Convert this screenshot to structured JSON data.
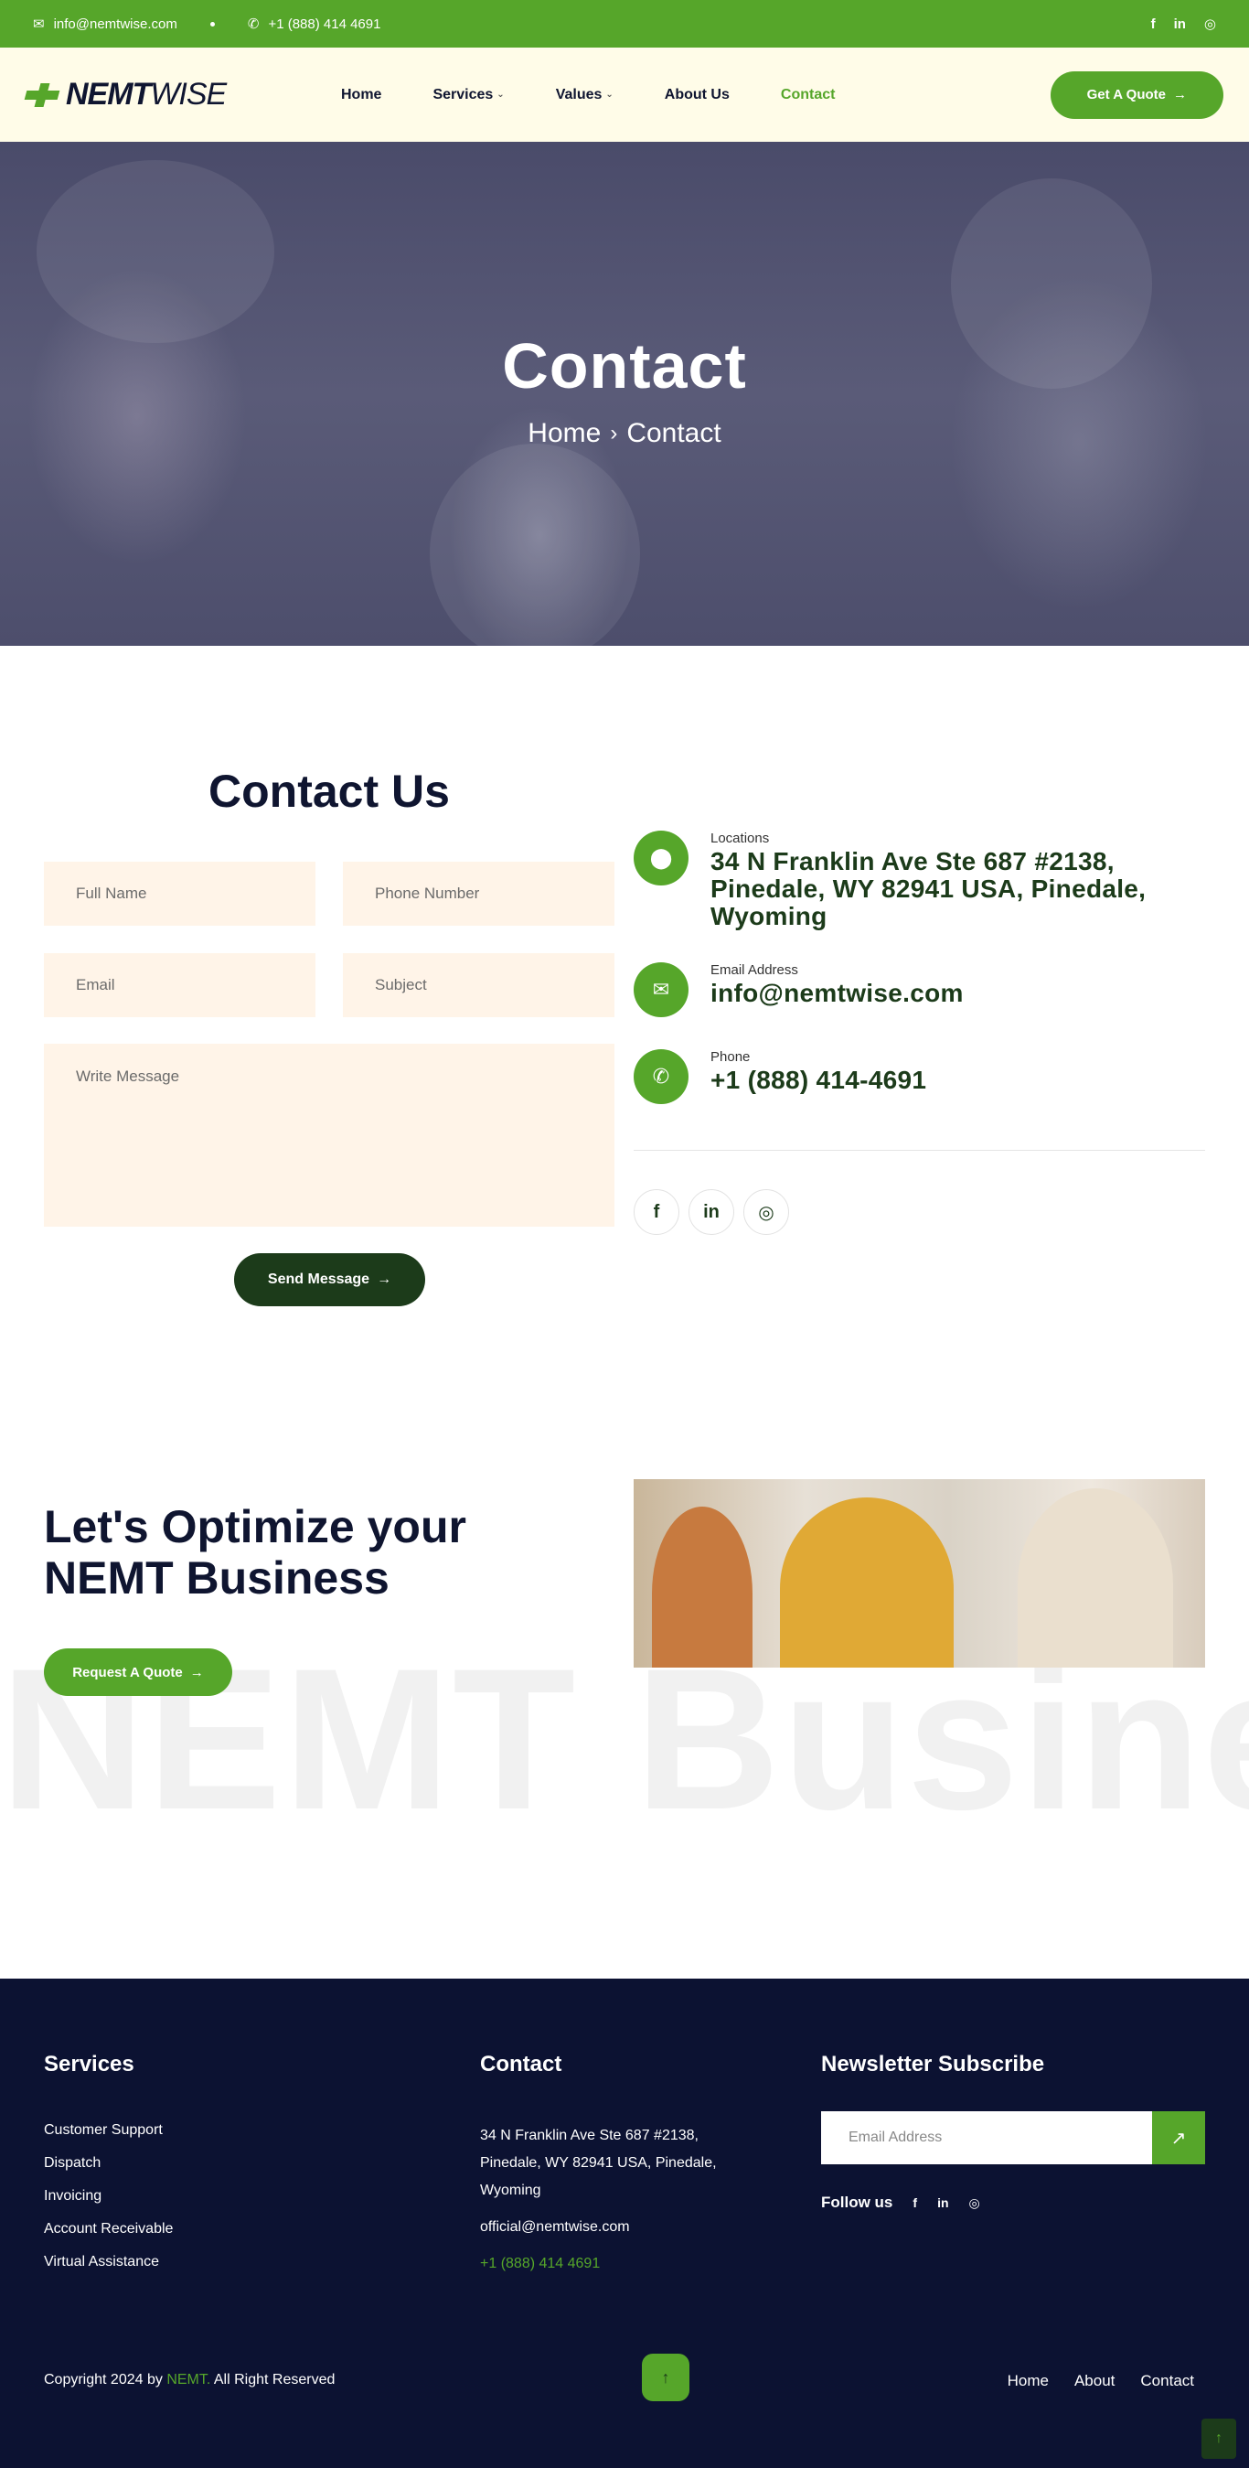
{
  "topbar": {
    "email": "info@nemtwise.com",
    "phone": "+1 (888) 414 4691",
    "social": [
      "f",
      "in",
      "◎"
    ]
  },
  "nav": {
    "logo_bold": "NEMT",
    "logo_light": "WISE",
    "items": [
      "Home",
      "Services",
      "Values",
      "About Us",
      "Contact"
    ],
    "quote_label": "Get A Quote"
  },
  "hero": {
    "title": "Contact",
    "crumb_home": "Home",
    "crumb_current": "Contact"
  },
  "contact": {
    "title": "Contact Us",
    "fields": {
      "full_name": "Full Name",
      "phone": "Phone Number",
      "email": "Email",
      "subject": "Subject",
      "message": "Write Message"
    },
    "send_label": "Send Message",
    "info": [
      {
        "label": "Locations",
        "value": "34 N Franklin Ave Ste 687 #2138, Pinedale, WY 82941 USA, Pinedale, Wyoming"
      },
      {
        "label": "Email Address",
        "value": "info@nemtwise.com"
      },
      {
        "label": "Phone",
        "value": "+1 (888) 414-4691"
      }
    ],
    "social": [
      "f",
      "in",
      "◎"
    ]
  },
  "optimize": {
    "title_line1": "Let's Optimize your",
    "title_line2": "NEMT Business",
    "button_label": "Request A Quote",
    "bg_text": "NEMT Busines"
  },
  "footer": {
    "services_title": "Services",
    "services": [
      "Customer Support",
      "Dispatch",
      "Invoicing",
      "Account Receivable",
      "Virtual Assistance"
    ],
    "contact_title": "Contact",
    "address": "34 N Franklin Ave Ste 687 #2138, Pinedale, WY 82941 USA, Pinedale, Wyoming",
    "email": "official@nemtwise.com",
    "phone": "+1 (888) 414 4691",
    "newsletter_title": "Newsletter Subscribe",
    "newsletter_placeholder": "Email Address",
    "follow_label": "Follow us",
    "copyright_pre": "Copyright 2024 by",
    "copyright_brand": "NEMT.",
    "copyright_post": "All Right Reserved",
    "links": [
      "Home",
      "About",
      "Contact"
    ]
  },
  "colors": {
    "accent": "#56a62a",
    "dark_green": "#1c3b1a",
    "navy": "#0c1232",
    "cream": "#fffce8",
    "field_bg": "#fff4e8"
  }
}
